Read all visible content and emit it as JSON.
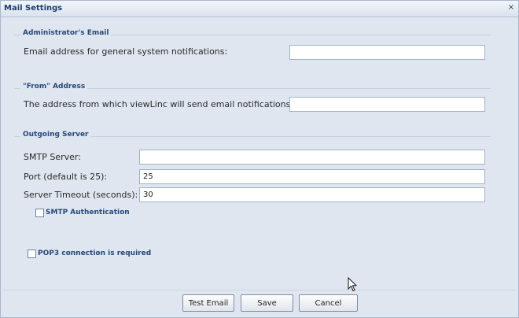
{
  "window": {
    "title": "Mail Settings",
    "close_glyph": "×"
  },
  "admin_email": {
    "legend": "Administrator's Email",
    "label": "Email address for general system notifications:",
    "value": ""
  },
  "from_address": {
    "legend": "\"From\" Address",
    "label": "The address from which viewLinc will send email notifications:",
    "value": ""
  },
  "outgoing_server": {
    "legend": "Outgoing Server",
    "smtp_label": "SMTP Server:",
    "smtp_value": "",
    "port_label": "Port (default is 25):",
    "port_value": "25",
    "timeout_label": "Server Timeout (seconds):",
    "timeout_value": "30",
    "smtp_auth_label": "SMTP Authentication",
    "smtp_auth_checked": false
  },
  "pop3": {
    "label": "POP3 connection is required",
    "checked": false
  },
  "buttons": {
    "test_email": "Test Email",
    "save": "Save",
    "cancel": "Cancel"
  },
  "icons": {
    "close": "close-icon",
    "cursor": "pointer-cursor-icon"
  },
  "colors": {
    "legend_text": "#24497a",
    "background": "#dfe6ef",
    "input_border": "#9fb2c8"
  }
}
